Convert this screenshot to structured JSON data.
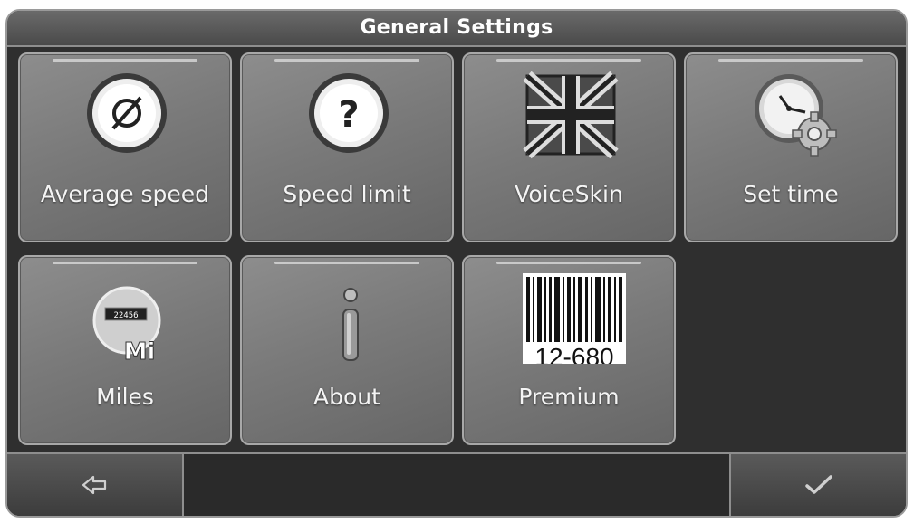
{
  "header": {
    "title": "General Settings"
  },
  "tiles": [
    {
      "label": "Average speed",
      "icon": "average-speed-icon"
    },
    {
      "label": "Speed limit",
      "icon": "speed-limit-icon"
    },
    {
      "label": "VoiceSkin",
      "icon": "union-flag-icon"
    },
    {
      "label": "Set time",
      "icon": "clock-gear-icon"
    },
    {
      "label": "Miles",
      "icon": "odometer-miles-icon",
      "icon_unit": "Mi",
      "icon_counter": "22456"
    },
    {
      "label": "About",
      "icon": "info-icon"
    },
    {
      "label": "Premium",
      "icon": "barcode-icon",
      "icon_code": "12-680"
    }
  ],
  "footer": {
    "back_icon": "back-arrow-icon",
    "confirm_icon": "checkmark-icon"
  }
}
